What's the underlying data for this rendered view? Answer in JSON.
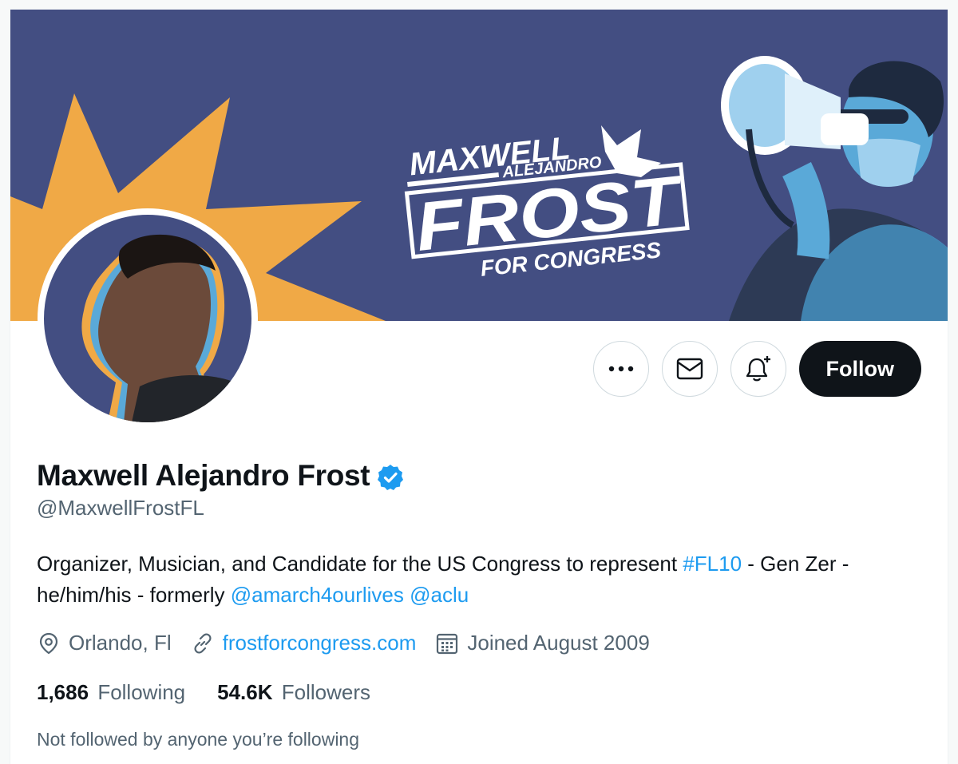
{
  "banner": {
    "title_top": "MAXWELL",
    "title_middle": "ALEJANDRO",
    "title_main": "FROST",
    "title_sub": "FOR CONGRESS",
    "bg_color": "#434e82",
    "star_color": "#f0a946",
    "text_color": "#ffffff"
  },
  "profile": {
    "display_name": "Maxwell Alejandro Frost",
    "handle": "@MaxwellFrostFL",
    "verified": true,
    "bio_text_1": "Organizer, Musician, and Candidate for the US Congress to represent ",
    "bio_hashtag": "#FL10",
    "bio_text_2": " - Gen Zer - he/him/his - formerly ",
    "bio_mention_1": "@amarch4ourlives",
    "bio_mention_2": "@aclu",
    "location": "Orlando, Fl",
    "website": "frostforcongress.com",
    "joined": "Joined August 2009"
  },
  "actions": {
    "more_icon": "ellipsis-icon",
    "message_icon": "envelope-icon",
    "notify_icon": "bell-plus-icon",
    "follow_label": "Follow"
  },
  "stats": {
    "following_count": "1,686",
    "following_label": "Following",
    "followers_count": "54.6K",
    "followers_label": "Followers"
  },
  "social_context": "Not followed by anyone you’re following",
  "colors": {
    "accent": "#1d9bf0",
    "secondary_text": "#536471",
    "primary_text": "#0f1419"
  }
}
